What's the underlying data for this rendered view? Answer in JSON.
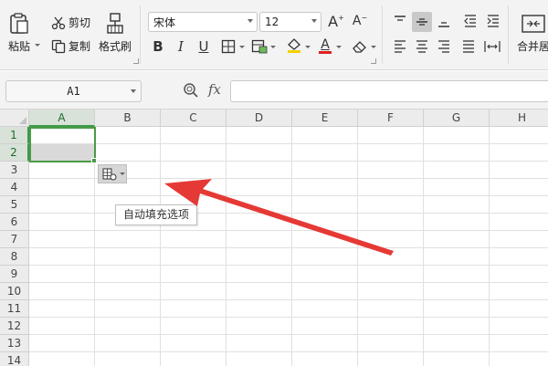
{
  "ribbon": {
    "paste_label": "粘贴",
    "cut_label": "剪切",
    "copy_label": "复制",
    "format_painter_label": "格式刷",
    "font_name": "宋体",
    "font_size": "12",
    "grow_font": "A",
    "shrink_font": "A",
    "bold": "B",
    "italic": "I",
    "underline": "U",
    "font_color_letter": "A",
    "merge_label": "合并居",
    "font_color": "#e02020",
    "highlight_color": "#f5d000"
  },
  "formula_bar": {
    "name_box": "A1",
    "fx_label": "fx",
    "formula": ""
  },
  "sheet": {
    "columns": [
      "A",
      "B",
      "C",
      "D",
      "E",
      "F",
      "G",
      "H"
    ],
    "rows": [
      "1",
      "2",
      "3",
      "4",
      "5",
      "6",
      "7",
      "8",
      "9",
      "10",
      "11",
      "12",
      "13",
      "14"
    ],
    "selected_column": "A",
    "selected_rows": [
      "1",
      "2"
    ]
  },
  "autofill": {
    "tooltip": "自动填充选项"
  },
  "colors": {
    "selection_green": "#4a9a47",
    "arrow_red": "#e53935"
  }
}
